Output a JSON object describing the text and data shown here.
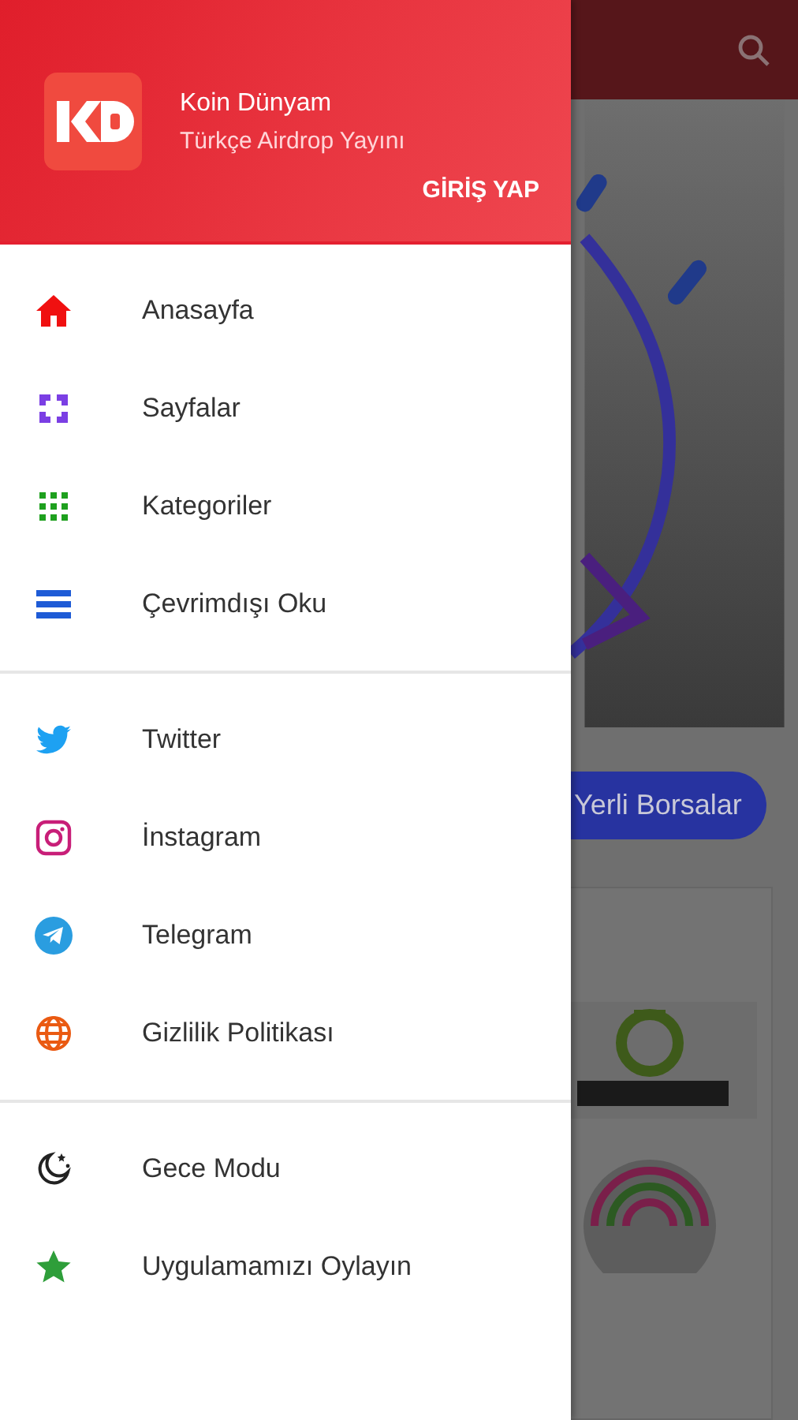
{
  "drawer": {
    "header": {
      "title": "Koin Dünyam",
      "subtitle": "Türkçe Airdrop Yayını",
      "login": "GİRİŞ YAP"
    },
    "sections": [
      [
        {
          "kind": "home",
          "label": "Anasayfa"
        },
        {
          "kind": "pages",
          "label": "Sayfalar"
        },
        {
          "kind": "grid",
          "label": "Kategoriler"
        },
        {
          "kind": "list",
          "label": "Çevrimdışı Oku"
        }
      ],
      [
        {
          "kind": "twitter",
          "label": "Twitter"
        },
        {
          "kind": "instagram",
          "label": "İnstagram"
        },
        {
          "kind": "telegram",
          "label": "Telegram"
        },
        {
          "kind": "globe",
          "label": "Gizlilik Politikası"
        }
      ],
      [
        {
          "kind": "moon",
          "label": "Gece Modu"
        },
        {
          "kind": "star",
          "label": "Uygulamamızı Oylayın"
        }
      ]
    ]
  },
  "background": {
    "chip": "Yerli Borsalar"
  }
}
